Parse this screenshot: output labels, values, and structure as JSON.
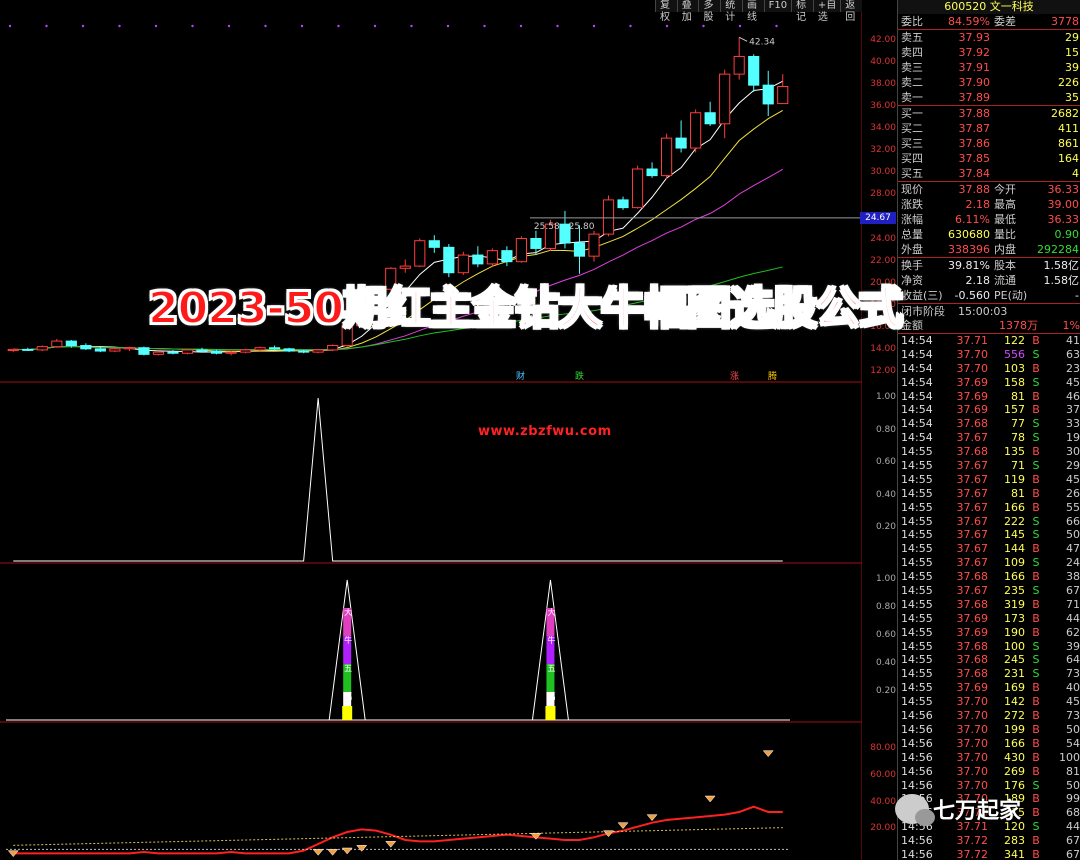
{
  "toolbar": [
    "复权",
    "叠加",
    "多股",
    "统计",
    "画线",
    "F10",
    "标记",
    "+自选",
    "返回"
  ],
  "stock_title": "600520 文一科技",
  "price_axis": [
    "42.00",
    "40.00",
    "38.00",
    "36.00",
    "34.00",
    "32.00",
    "30.00",
    "28.00",
    "26.00",
    "24.00",
    "22.00",
    "20.00",
    "18.00",
    "16.00",
    "14.00",
    "12.00"
  ],
  "current_price_marker": "24.67",
  "high_label": "42.34",
  "range_label": "25.58 - 25.80",
  "event_labels": [
    "财",
    "跌",
    "涨",
    "腾"
  ],
  "ind1_axis": [
    "1.00",
    "0.80",
    "0.60",
    "0.40",
    "0.20"
  ],
  "ind2_axis": [
    "1.00",
    "0.80",
    "0.60",
    "0.40",
    "0.20"
  ],
  "ind3_axis": [
    "80.00",
    "60.00",
    "40.00",
    "20.00"
  ],
  "signal_chars": [
    "大",
    "牛",
    "五",
    "幅"
  ],
  "banner": "2023-50期红主金钻大牛幅图选股公式",
  "website": "www.zbzfwu.com",
  "wechat": "七万起家",
  "quote": {
    "weibi_label": "委比",
    "weibi": "84.59%",
    "weicha_label": "委差",
    "weicha": "3778",
    "asks": [
      {
        "label": "卖五",
        "price": "37.93",
        "vol": "29"
      },
      {
        "label": "卖四",
        "price": "37.92",
        "vol": "15"
      },
      {
        "label": "卖三",
        "price": "37.91",
        "vol": "39"
      },
      {
        "label": "卖二",
        "price": "37.90",
        "vol": "226"
      },
      {
        "label": "卖一",
        "price": "37.89",
        "vol": "35"
      }
    ],
    "bids": [
      {
        "label": "买一",
        "price": "37.88",
        "vol": "2682"
      },
      {
        "label": "买二",
        "price": "37.87",
        "vol": "411"
      },
      {
        "label": "买三",
        "price": "37.86",
        "vol": "861"
      },
      {
        "label": "买四",
        "price": "37.85",
        "vol": "164"
      },
      {
        "label": "买五",
        "price": "37.84",
        "vol": "4"
      }
    ],
    "stats": [
      {
        "l1": "现价",
        "v1": "37.88",
        "c1": "red",
        "l2": "今开",
        "v2": "36.33",
        "c2": "red"
      },
      {
        "l1": "涨跌",
        "v1": "2.18",
        "c1": "red",
        "l2": "最高",
        "v2": "39.00",
        "c2": "red"
      },
      {
        "l1": "涨幅",
        "v1": "6.11%",
        "c1": "red",
        "l2": "最低",
        "v2": "36.33",
        "c2": "red"
      },
      {
        "l1": "总量",
        "v1": "630680",
        "c1": "yellow",
        "l2": "量比",
        "v2": "0.90",
        "c2": "green"
      },
      {
        "l1": "外盘",
        "v1": "338396",
        "c1": "red",
        "l2": "内盘",
        "v2": "292284",
        "c2": "green"
      }
    ],
    "stats2": [
      {
        "l1": "换手",
        "v1": "39.81%",
        "c1": "white",
        "l2": "股本",
        "v2": "1.58亿",
        "c2": "white"
      },
      {
        "l1": "净资",
        "v1": "2.18",
        "c1": "white",
        "l2": "流通",
        "v2": "1.58亿",
        "c2": "white"
      },
      {
        "l1": "收益(三)",
        "v1": "-0.560",
        "c1": "white",
        "l2": "PE(动)",
        "v2": "-",
        "c2": "white"
      }
    ],
    "phase_label": "闭市阶段",
    "phase_time": "15:00:03",
    "amount_label": "金额",
    "amount": "1378万",
    "amount_pct": "1%"
  },
  "ticks": [
    [
      "14:54",
      "37.71",
      "122",
      "B",
      "41"
    ],
    [
      "14:54",
      "37.70",
      "556",
      "S",
      "63"
    ],
    [
      "14:54",
      "37.70",
      "103",
      "B",
      "23"
    ],
    [
      "14:54",
      "37.69",
      "158",
      "S",
      "45"
    ],
    [
      "14:54",
      "37.69",
      "81",
      "B",
      "46"
    ],
    [
      "14:54",
      "37.69",
      "157",
      "B",
      "37"
    ],
    [
      "14:54",
      "37.68",
      "77",
      "S",
      "33"
    ],
    [
      "14:54",
      "37.67",
      "78",
      "S",
      "19"
    ],
    [
      "14:55",
      "37.68",
      "135",
      "B",
      "30"
    ],
    [
      "14:55",
      "37.67",
      "71",
      "S",
      "29"
    ],
    [
      "14:55",
      "37.67",
      "119",
      "B",
      "45"
    ],
    [
      "14:55",
      "37.67",
      "81",
      "B",
      "26"
    ],
    [
      "14:55",
      "37.67",
      "166",
      "B",
      "55"
    ],
    [
      "14:55",
      "37.67",
      "222",
      "S",
      "66"
    ],
    [
      "14:55",
      "37.67",
      "145",
      "S",
      "50"
    ],
    [
      "14:55",
      "37.67",
      "144",
      "B",
      "47"
    ],
    [
      "14:55",
      "37.67",
      "109",
      "S",
      "24"
    ],
    [
      "14:55",
      "37.68",
      "166",
      "B",
      "38"
    ],
    [
      "14:55",
      "37.67",
      "235",
      "S",
      "67"
    ],
    [
      "14:55",
      "37.68",
      "319",
      "B",
      "71"
    ],
    [
      "14:55",
      "37.69",
      "173",
      "B",
      "44"
    ],
    [
      "14:55",
      "37.69",
      "190",
      "B",
      "62"
    ],
    [
      "14:55",
      "37.68",
      "100",
      "S",
      "39"
    ],
    [
      "14:55",
      "37.68",
      "245",
      "S",
      "64"
    ],
    [
      "14:55",
      "37.68",
      "231",
      "S",
      "73"
    ],
    [
      "14:55",
      "37.69",
      "169",
      "B",
      "40"
    ],
    [
      "14:55",
      "37.70",
      "142",
      "B",
      "45"
    ],
    [
      "14:56",
      "37.70",
      "272",
      "B",
      "73"
    ],
    [
      "14:56",
      "37.70",
      "199",
      "B",
      "50"
    ],
    [
      "14:56",
      "37.70",
      "166",
      "B",
      "54"
    ],
    [
      "14:56",
      "37.70",
      "430",
      "B",
      "100"
    ],
    [
      "14:56",
      "37.70",
      "269",
      "B",
      "81"
    ],
    [
      "14:56",
      "37.70",
      "176",
      "S",
      "50"
    ],
    [
      "14:56",
      "37.70",
      "189",
      "B",
      "99"
    ],
    [
      "14:56",
      "37.70",
      "215",
      "B",
      "68"
    ],
    [
      "14:56",
      "37.71",
      "120",
      "S",
      "44"
    ],
    [
      "14:56",
      "37.72",
      "283",
      "B",
      "67"
    ],
    [
      "14:56",
      "37.72",
      "341",
      "B",
      "67"
    ]
  ],
  "chart_data": {
    "type": "candlestick",
    "candles": [
      [
        13.95,
        14.1,
        13.8,
        14.05
      ],
      [
        14.05,
        14.2,
        13.9,
        14.0
      ],
      [
        14.0,
        14.4,
        13.9,
        14.3
      ],
      [
        14.3,
        15.0,
        14.2,
        14.8
      ],
      [
        14.8,
        14.9,
        14.2,
        14.4
      ],
      [
        14.4,
        14.6,
        14.0,
        14.1
      ],
      [
        14.1,
        14.3,
        13.8,
        13.9
      ],
      [
        13.9,
        14.2,
        13.8,
        14.1
      ],
      [
        14.1,
        14.3,
        13.9,
        14.2
      ],
      [
        14.2,
        14.3,
        13.5,
        13.6
      ],
      [
        13.6,
        13.9,
        13.5,
        13.8
      ],
      [
        13.8,
        14.0,
        13.6,
        13.7
      ],
      [
        13.7,
        14.1,
        13.6,
        14.0
      ],
      [
        14.0,
        14.2,
        13.8,
        13.9
      ],
      [
        13.9,
        14.0,
        13.6,
        13.7
      ],
      [
        13.7,
        13.9,
        13.5,
        13.8
      ],
      [
        13.8,
        14.1,
        13.7,
        14.0
      ],
      [
        14.0,
        14.3,
        13.9,
        14.2
      ],
      [
        14.2,
        14.4,
        14.0,
        14.1
      ],
      [
        14.1,
        14.2,
        13.8,
        13.9
      ],
      [
        13.9,
        14.0,
        13.7,
        13.8
      ],
      [
        13.8,
        14.1,
        13.7,
        14.0
      ],
      [
        14.0,
        14.5,
        13.9,
        14.4
      ],
      [
        14.4,
        16.5,
        14.3,
        16.2
      ],
      [
        16.2,
        18.0,
        16.0,
        17.8
      ],
      [
        17.8,
        19.6,
        17.6,
        19.5
      ],
      [
        19.5,
        21.5,
        19.4,
        21.4
      ],
      [
        21.4,
        22.2,
        21.0,
        21.6
      ],
      [
        21.6,
        24.1,
        21.5,
        23.9
      ],
      [
        23.9,
        24.4,
        22.8,
        23.3
      ],
      [
        23.3,
        23.6,
        20.6,
        21.0
      ],
      [
        21.0,
        22.9,
        20.8,
        22.6
      ],
      [
        22.6,
        23.4,
        21.5,
        21.8
      ],
      [
        21.8,
        23.2,
        21.5,
        23.0
      ],
      [
        23.0,
        23.4,
        21.6,
        22.0
      ],
      [
        22.0,
        24.3,
        21.9,
        24.1
      ],
      [
        24.1,
        24.8,
        22.6,
        23.2
      ],
      [
        23.2,
        25.8,
        23.0,
        25.4
      ],
      [
        25.4,
        26.6,
        23.2,
        23.7
      ],
      [
        23.7,
        25.3,
        20.9,
        22.5
      ],
      [
        22.5,
        24.8,
        22.0,
        24.5
      ],
      [
        24.5,
        28.0,
        24.3,
        27.6
      ],
      [
        27.6,
        27.9,
        26.7,
        26.9
      ],
      [
        26.9,
        30.7,
        26.8,
        30.4
      ],
      [
        30.4,
        31.0,
        29.6,
        29.8
      ],
      [
        29.8,
        33.6,
        29.5,
        33.2
      ],
      [
        33.2,
        34.8,
        31.9,
        32.3
      ],
      [
        32.3,
        35.8,
        31.9,
        35.5
      ],
      [
        35.5,
        36.5,
        34.3,
        34.5
      ],
      [
        34.5,
        39.4,
        33.2,
        39.0
      ],
      [
        39.0,
        42.34,
        38.5,
        40.6
      ],
      [
        40.6,
        40.8,
        37.4,
        38.0
      ],
      [
        38.0,
        39.3,
        35.2,
        36.3
      ],
      [
        36.33,
        39.0,
        36.33,
        37.88
      ]
    ],
    "ylim": [
      12,
      43
    ],
    "indicator1": [
      0,
      0,
      0,
      0,
      0,
      0,
      0,
      0,
      0,
      0,
      0,
      0,
      0,
      0,
      0,
      0,
      0,
      0,
      0,
      0,
      0,
      1,
      0,
      0,
      0,
      0,
      0,
      0,
      0,
      0,
      0,
      0,
      0,
      0,
      0,
      0,
      0,
      0,
      0,
      0,
      0,
      0,
      0,
      0,
      0,
      0,
      0,
      0,
      0,
      0,
      0,
      0,
      0,
      0
    ],
    "indicator2_peaks": [
      23,
      37
    ],
    "indicator3": [
      2,
      2,
      2,
      2,
      2,
      2,
      2,
      2,
      2,
      3,
      2,
      2,
      2,
      2,
      2,
      3,
      2,
      2,
      2,
      2,
      4,
      9,
      14,
      18,
      20,
      19,
      16,
      12,
      11,
      11,
      12,
      13,
      14,
      15,
      16,
      15,
      14,
      13,
      12,
      12,
      14,
      17,
      19,
      22,
      25,
      27,
      28,
      29,
      30,
      31,
      33,
      37,
      33,
      33
    ]
  }
}
